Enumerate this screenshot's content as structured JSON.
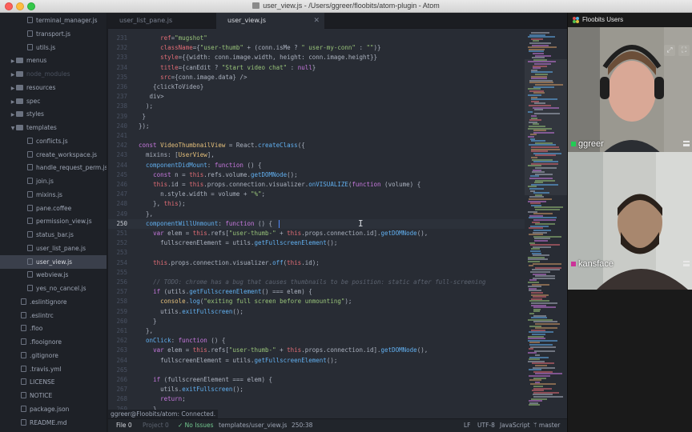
{
  "window": {
    "title": "user_view.js - /Users/ggreer/floobits/atom-plugin - Atom"
  },
  "tree": {
    "items": [
      {
        "label": "terminal_manager.js",
        "kind": "file",
        "depth": 2
      },
      {
        "label": "transport.js",
        "kind": "file",
        "depth": 2
      },
      {
        "label": "utils.js",
        "kind": "file",
        "depth": 2
      },
      {
        "label": "menus",
        "kind": "folder",
        "depth": 0
      },
      {
        "label": "node_modules",
        "kind": "folder-dim",
        "depth": 0
      },
      {
        "label": "resources",
        "kind": "folder",
        "depth": 0
      },
      {
        "label": "spec",
        "kind": "folder",
        "depth": 0
      },
      {
        "label": "styles",
        "kind": "folder",
        "depth": 0
      },
      {
        "label": "templates",
        "kind": "folder-open",
        "depth": 0
      },
      {
        "label": "conflicts.js",
        "kind": "file",
        "depth": 2
      },
      {
        "label": "create_workspace.js",
        "kind": "file",
        "depth": 2
      },
      {
        "label": "handle_request_perm.js",
        "kind": "file",
        "depth": 2
      },
      {
        "label": "join.js",
        "kind": "file",
        "depth": 2
      },
      {
        "label": "mixins.js",
        "kind": "file",
        "depth": 2
      },
      {
        "label": "pane.coffee",
        "kind": "file",
        "depth": 2
      },
      {
        "label": "permission_view.js",
        "kind": "file",
        "depth": 2
      },
      {
        "label": "status_bar.js",
        "kind": "file",
        "depth": 2
      },
      {
        "label": "user_list_pane.js",
        "kind": "file",
        "depth": 2
      },
      {
        "label": "user_view.js",
        "kind": "file-selected",
        "depth": 2
      },
      {
        "label": "webview.js",
        "kind": "file",
        "depth": 2
      },
      {
        "label": "yes_no_cancel.js",
        "kind": "file",
        "depth": 2
      },
      {
        "label": ".eslintignore",
        "kind": "file",
        "depth": 1
      },
      {
        "label": ".eslintrc",
        "kind": "file",
        "depth": 1
      },
      {
        "label": ".floo",
        "kind": "file",
        "depth": 1
      },
      {
        "label": ".flooignore",
        "kind": "file",
        "depth": 1
      },
      {
        "label": ".gitignore",
        "kind": "file",
        "depth": 1
      },
      {
        "label": ".travis.yml",
        "kind": "file",
        "depth": 1
      },
      {
        "label": "LICENSE",
        "kind": "file",
        "depth": 1
      },
      {
        "label": "NOTICE",
        "kind": "file",
        "depth": 1
      },
      {
        "label": "package.json",
        "kind": "file",
        "depth": 1
      },
      {
        "label": "README.md",
        "kind": "file",
        "depth": 1
      }
    ]
  },
  "tabs": [
    {
      "label": "user_list_pane.js",
      "active": false
    },
    {
      "label": "user_view.js",
      "active": true
    }
  ],
  "editor": {
    "current_line": "250",
    "lines": [
      {
        "n": "231",
        "html": "      <span class=\"p\">ref</span>=<span class=\"s\">\"mugshot\"</span>"
      },
      {
        "n": "232",
        "html": "      <span class=\"p\">className</span>={<span class=\"s\">\"user-thumb\"</span> + (conn.isMe ? <span class=\"s\">\" user-my-conn\"</span> : <span class=\"s\">\"\"</span>)}"
      },
      {
        "n": "233",
        "html": "      <span class=\"p\">style</span>={{width: conn.image.width, height: conn.image.height}}"
      },
      {
        "n": "234",
        "html": "      <span class=\"p\">title</span>={canEdit ? <span class=\"s\">\"Start video chat\"</span> : <span class=\"k\">null</span>}"
      },
      {
        "n": "235",
        "html": "      <span class=\"p\">src</span>={conn.image.data} />"
      },
      {
        "n": "236",
        "html": "    {clickToVideo}"
      },
      {
        "n": "237",
        "html": "   </<span class=\"p\">div</span>>"
      },
      {
        "n": "238",
        "html": "  );"
      },
      {
        "n": "239",
        "html": " }"
      },
      {
        "n": "240",
        "html": "});"
      },
      {
        "n": "241",
        "html": ""
      },
      {
        "n": "242",
        "html": "<span class=\"k\">const</span> <span class=\"y\">VideoThumbnailView</span> = React.<span class=\"f\">createClass</span>({"
      },
      {
        "n": "243",
        "html": "  mixins: [<span class=\"y\">UserView</span>],"
      },
      {
        "n": "244",
        "html": "  <span class=\"f\">componentDidMount</span>: <span class=\"k\">function</span> () {"
      },
      {
        "n": "245",
        "html": "    <span class=\"k\">const</span> n = <span class=\"p\">this</span>.refs.volume.<span class=\"f\">getDOMNode</span>();"
      },
      {
        "n": "246",
        "html": "    <span class=\"p\">this</span>.id = <span class=\"p\">this</span>.props.connection.visualizer.<span class=\"f\">onVISUALIZE</span>(<span class=\"k\">function</span> (volume) {"
      },
      {
        "n": "247",
        "html": "      n.style.width = volume + <span class=\"s\">\"%\"</span>;"
      },
      {
        "n": "248",
        "html": "    }, <span class=\"p\">this</span>);"
      },
      {
        "n": "249",
        "html": "  },"
      },
      {
        "n": "250",
        "html": "  <span class=\"f\">componentWillUnmount</span>: <span class=\"k\">function</span> () {"
      },
      {
        "n": "251",
        "html": "    <span class=\"k\">var</span> elem = <span class=\"p\">this</span>.refs[<span class=\"s\">\"user-thumb-\"</span> + <span class=\"p\">this</span>.props.connection.id].<span class=\"f\">getDOMNode</span>(),"
      },
      {
        "n": "252",
        "html": "      fullscreenElement = utils.<span class=\"f\">getFullscreenElement</span>();"
      },
      {
        "n": "253",
        "html": ""
      },
      {
        "n": "254",
        "html": "    <span class=\"p\">this</span>.props.connection.visualizer.<span class=\"f\">off</span>(<span class=\"p\">this</span>.id);"
      },
      {
        "n": "255",
        "html": ""
      },
      {
        "n": "256",
        "html": "    <span class=\"c\">// TODO: chrome has a bug that causes thumbnails to be position: static after full-screening</span>"
      },
      {
        "n": "257",
        "html": "    <span class=\"k\">if</span> (utils.<span class=\"f\">getFullscreenElement</span>() === elem) {"
      },
      {
        "n": "258",
        "html": "      <span class=\"y\">console</span>.<span class=\"f\">log</span>(<span class=\"s\">\"exiting full screen before unmounting\"</span>);"
      },
      {
        "n": "259",
        "html": "      utils.<span class=\"f\">exitFullscreen</span>();"
      },
      {
        "n": "260",
        "html": "    }"
      },
      {
        "n": "261",
        "html": "  },"
      },
      {
        "n": "262",
        "html": "  <span class=\"f\">onClick</span>: <span class=\"k\">function</span> () {"
      },
      {
        "n": "263",
        "html": "    <span class=\"k\">var</span> elem = <span class=\"p\">this</span>.refs[<span class=\"s\">\"user-thumb-\"</span> + <span class=\"p\">this</span>.props.connection.id].<span class=\"f\">getDOMNode</span>(),"
      },
      {
        "n": "264",
        "html": "      fullscreenElement = utils.<span class=\"f\">getFullscreenElement</span>();"
      },
      {
        "n": "265",
        "html": ""
      },
      {
        "n": "266",
        "html": "    <span class=\"k\">if</span> (fullscreenElement === elem) {"
      },
      {
        "n": "267",
        "html": "      utils.<span class=\"f\">exitFullscreen</span>();"
      },
      {
        "n": "268",
        "html": "      <span class=\"k\">return</span>;"
      },
      {
        "n": "269",
        "html": "    }"
      }
    ]
  },
  "status": {
    "connected": "ggreer@Floobits/atom: Connected.",
    "file_tab": "File 0",
    "project_tab": "Project 0",
    "issues": "No Issues",
    "path": "templates/user_view.js",
    "cursor": "250:38",
    "line_ending": "LF",
    "encoding": "UTF-8",
    "grammar": "JavaScript",
    "branch": "master"
  },
  "floobits": {
    "title": "Floobits Users",
    "users": [
      {
        "name": "ggreer",
        "color": "#22cc55"
      },
      {
        "name": "kansface",
        "color": "#cc3399"
      }
    ]
  }
}
